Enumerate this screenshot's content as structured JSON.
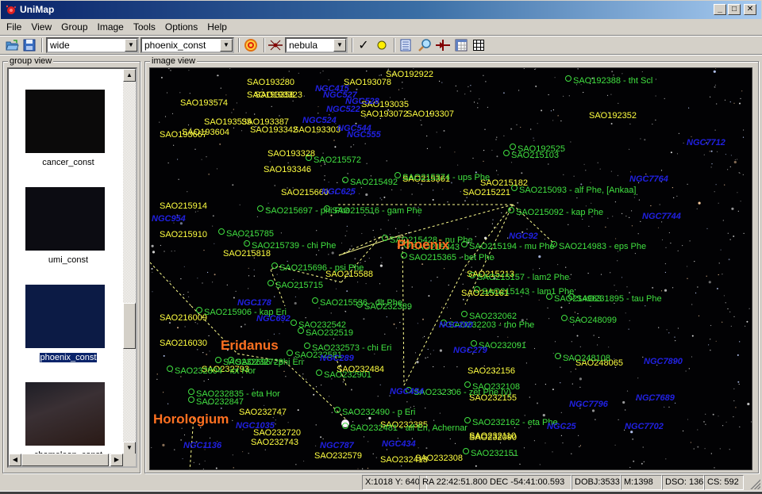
{
  "window": {
    "title": "UniMap",
    "controls": {
      "minimize": "_",
      "maximize": "□",
      "close": "✕"
    }
  },
  "menu": [
    "File",
    "View",
    "Group",
    "Image",
    "Tools",
    "Options",
    "Help"
  ],
  "toolbar": {
    "open_icon": "folder-open-icon",
    "save_icon": "save-icon",
    "view_mode": "wide",
    "image_select": "phoenix_const",
    "target_icon": "target-icon",
    "detect_icon": "star-detect-icon",
    "object_type": "nebula",
    "check_icon": "checkmark-icon",
    "circle_icon": "yellow-circle-icon",
    "list_icon": "list-icon",
    "search_icon": "magnifier-icon",
    "align_icon": "align-icon",
    "table_icon": "table-icon",
    "grid_icon": "grid-icon"
  },
  "group_view": {
    "title": "group view",
    "items": [
      {
        "label": "cancer_const",
        "selected": false,
        "color": "#0b0a0a"
      },
      {
        "label": "umi_const",
        "selected": false,
        "color": "#0c0c12"
      },
      {
        "label": "phoenix_const",
        "selected": true,
        "color": "#0c1b45"
      },
      {
        "label": "chameleon_const",
        "selected": false,
        "color": "#2a2226"
      }
    ]
  },
  "image_view": {
    "title": "image view",
    "constellations": [
      {
        "name": "Phoenix"
      },
      {
        "name": "Eridanus"
      },
      {
        "name": "Horologium"
      }
    ],
    "sao_labels": [
      "SAO193280",
      "SAO193078",
      "SAO192922",
      "SAO193323",
      "SAO193358",
      "SAO193574",
      "SAO193035",
      "SAO193307",
      "SAO193072",
      "SAO193535",
      "SAO193387",
      "SAO193604",
      "SAO193667",
      "SAO193303",
      "SAO193342",
      "SAO193328",
      "SAO193346",
      "SAO215660",
      "SAO215914",
      "SAO215910",
      "SAO215818",
      "SAO215588",
      "SAO215361",
      "SAO215221",
      "SAO215182",
      "SAO215213",
      "SAO215161",
      "SAO216009",
      "SAO216030",
      "SAO232793",
      "SAO232484",
      "SAO232747",
      "SAO232720",
      "SAO232743",
      "SAO232579",
      "SAO232385",
      "SAO232156",
      "SAO232155",
      "SAO232110",
      "SAO232090",
      "SAO232308",
      "SAO232418",
      "SAO248065",
      "SAO192352"
    ],
    "star_labels": [
      "SAO192388 - tht Scl",
      "SAO215572",
      "SAO215492",
      "SAO215374 - ups Phe",
      "SAO192525",
      "SAO215103",
      "SAO215093 - alf Phe, [Ankaa]",
      "SAO215092 - kap Phe",
      "SAO215697 - phi Phe",
      "SAO215516 - gam Phe",
      "SAO215785",
      "SAO215739 - chi Phe",
      "SAO215428 - nu Phe",
      "SAO215365 - bet Phe",
      "SAO215343",
      "SAO215194 - mu Phe",
      "SAO214983 - eps Phe",
      "SAO215696 - psi Phe",
      "SAO215715",
      "SAO215157 - lam2 Phe",
      "SAO215143 - lam1 Phe",
      "SAO214963",
      "SAO231895 - tau Phe",
      "SAO248099",
      "SAO215536 - dlt Phe",
      "SAO232389",
      "SAO215906 - kap Eri",
      "SAO232542",
      "SAO232519",
      "SAO232573 - chi Eri",
      "SAO232581",
      "SAO232696 - phi Eri",
      "SAO232729",
      "SAO232804 - iot Hor",
      "SAO232901",
      "SAO232835 - eta Hor",
      "SAO232847",
      "SAO232203 - rho Phe",
      "SAO232062",
      "SAO232091",
      "SAO248108",
      "SAO232108",
      "SAO232306 - zet Phe (v)",
      "SAO232490 - p Eri",
      "SAO232481 - alf Eri, Achernar",
      "SAO232162 - eta Phe",
      "SAO232151"
    ],
    "ngc_labels": [
      "NGC415",
      "NGC527",
      "NGC528",
      "NGC522",
      "NGC524",
      "NGC544",
      "NGC555",
      "NGC7712",
      "NGC7764",
      "NGC7744",
      "NGC625",
      "NGC954",
      "NGC692",
      "NGC92",
      "NGC178",
      "NGC200",
      "NGC279",
      "NGC289",
      "NGC454",
      "NGC1035",
      "NGC1136",
      "NGC787",
      "NGC434",
      "NGC7890",
      "NGC7689",
      "NGC7796",
      "NGC7702",
      "NGC25"
    ]
  },
  "status": {
    "xy": "X:1018 Y: 640",
    "radec": "RA  22:42:51.800 DEC -54:41:00.593",
    "dobj": "DOBJ:3533",
    "m": "M:1398",
    "dso": "DSO: 136",
    "cs": "CS: 592"
  }
}
